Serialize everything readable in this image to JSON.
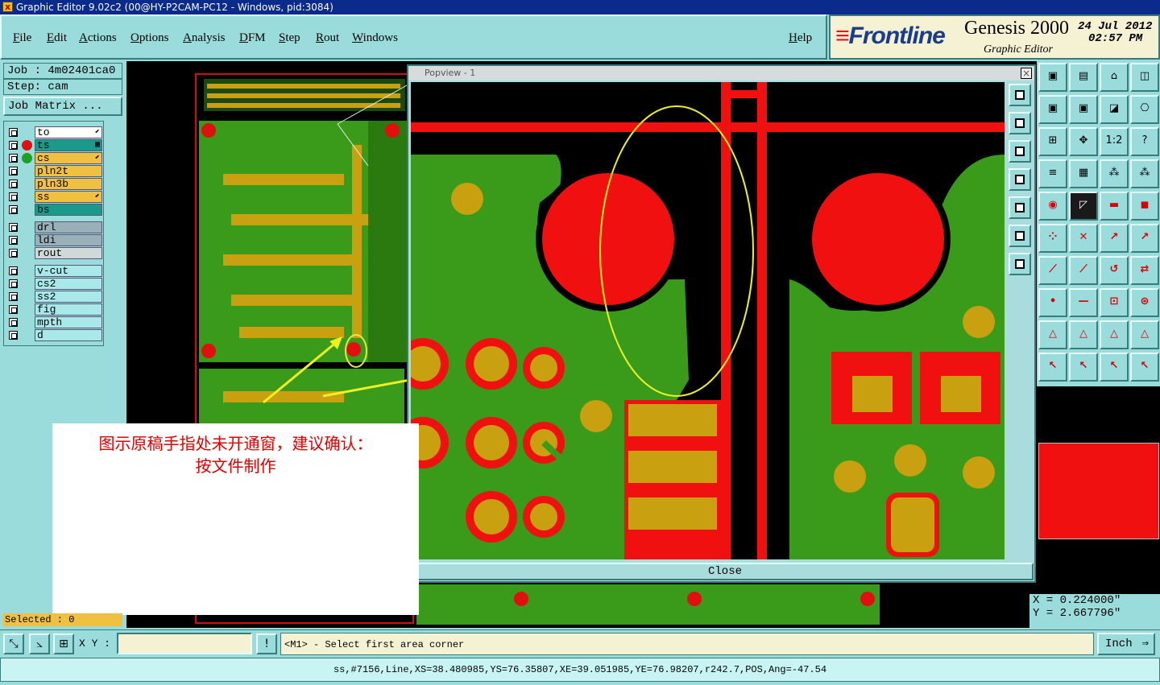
{
  "window": {
    "title": "Graphic Editor 9.02c2 (00@HY-P2CAM-PC12 - Windows, pid:3084)"
  },
  "menu": [
    "File",
    "Edit",
    "Actions",
    "Options",
    "Analysis",
    "DFM",
    "Step",
    "Rout",
    "Windows"
  ],
  "help_label": "Help",
  "brand": {
    "logo": "Frontline",
    "product": "Genesis 2000",
    "subtitle": "Graphic Editor",
    "date": "24 Jul 2012",
    "time": "02:57 PM"
  },
  "job": {
    "job_line": "Job : 4m02401ca0",
    "step_line": "Step: cam",
    "matrix_button": "Job Matrix ..."
  },
  "layers": [
    {
      "name": "to",
      "color": "#ffffff",
      "dot": "",
      "mark": "⬋"
    },
    {
      "name": "ts",
      "color": "#1a9a8a",
      "dot": "#e01010",
      "mark": "▦"
    },
    {
      "name": "cs",
      "color": "#f0c040",
      "dot": "#20a020",
      "mark": "⬋"
    },
    {
      "name": "pln2t",
      "color": "#f0c040",
      "dot": "",
      "mark": ""
    },
    {
      "name": "pln3b",
      "color": "#f0c040",
      "dot": "",
      "mark": ""
    },
    {
      "name": "ss",
      "color": "#f0c040",
      "dot": "",
      "mark": "⬋"
    },
    {
      "name": "bs",
      "color": "#1a9a8a",
      "dot": "",
      "mark": ""
    },
    {
      "name": "drl",
      "color": "#9ab0b8",
      "dot": "",
      "mark": ""
    },
    {
      "name": "ldi",
      "color": "#9ab0b8",
      "dot": "",
      "mark": ""
    },
    {
      "name": "rout",
      "color": "#d0d8d8",
      "dot": "",
      "mark": ""
    },
    {
      "name": "v-cut",
      "color": "#a8e8e8",
      "dot": "",
      "mark": ""
    },
    {
      "name": "cs2",
      "color": "#a8e8e8",
      "dot": "",
      "mark": ""
    },
    {
      "name": "ss2",
      "color": "#a8e8e8",
      "dot": "",
      "mark": ""
    },
    {
      "name": "fig",
      "color": "#a8e8e8",
      "dot": "",
      "mark": ""
    },
    {
      "name": "mpth",
      "color": "#a8e8e8",
      "dot": "",
      "mark": ""
    },
    {
      "name": "d",
      "color": "#a8e8e8",
      "dot": "",
      "mark": ""
    }
  ],
  "popview": {
    "title": "Popview - 1",
    "close_x": "×",
    "close_button": "Close"
  },
  "annotation": {
    "line1": "图示原稿手指处未开通窗，建议确认：",
    "line2": "按文件制作"
  },
  "selected_label": "Selected : 0",
  "coords": {
    "x": "X = 0.224000\"",
    "y": "Y = 2.667796\""
  },
  "bottom": {
    "xy_label": "X Y :",
    "xy_value": "",
    "message": "<M1> - Select first area corner",
    "unit": "Inch",
    "bang": "!"
  },
  "status_line": "ss,#7156,Line,XS=38.480985,YS=76.35807,XE=39.051985,YE=76.98207,r242.7,POS,Ang=-47.54",
  "toolbar_icons": [
    "window-icon",
    "layer-icon",
    "home-icon",
    "split-icon",
    "zoom-icon",
    "zoom2-icon",
    "swap-icon",
    "rotate-icon",
    "fit-icon",
    "pan-icon",
    "ratio-icon",
    "help-icon",
    "measure-icon",
    "grid-icon",
    "snap-icon",
    "snap2-icon",
    "pad-icon",
    "line-icon",
    "ruler-icon",
    "circle-icon",
    "net-icon",
    "cross-icon",
    "move-icon",
    "move2-icon",
    "slope-icon",
    "edit-line-icon",
    "arc-icon",
    "flip-icon",
    "point-icon",
    "dash-icon",
    "shape-icon",
    "group-icon",
    "tri-icon",
    "tri2-icon",
    "tri3-icon",
    "tri4-icon",
    "select-icon",
    "select2-icon",
    "select3-icon",
    "select4-icon"
  ],
  "toolbar_glyphs": [
    "▣",
    "▤",
    "⌂",
    "◫",
    "▣",
    "▣",
    "◪",
    "⎔",
    "⊞",
    "✥",
    "1:2",
    "?",
    "≡",
    "▦",
    "⁂",
    "⁂",
    "◉",
    "◸",
    "▬",
    "◼",
    "⁘",
    "✕",
    "↗",
    "↗",
    "⟋",
    "⟋",
    "↺",
    "⇄",
    "•",
    "—",
    "⊡",
    "⊛",
    "△",
    "△",
    "△",
    "△",
    "↖",
    "↖",
    "↖",
    "↖"
  ],
  "colors": {
    "board_green": "#3a9a1a",
    "copper_red": "#f01010",
    "pad_gold": "#c8a010",
    "bg_black": "#000000"
  }
}
